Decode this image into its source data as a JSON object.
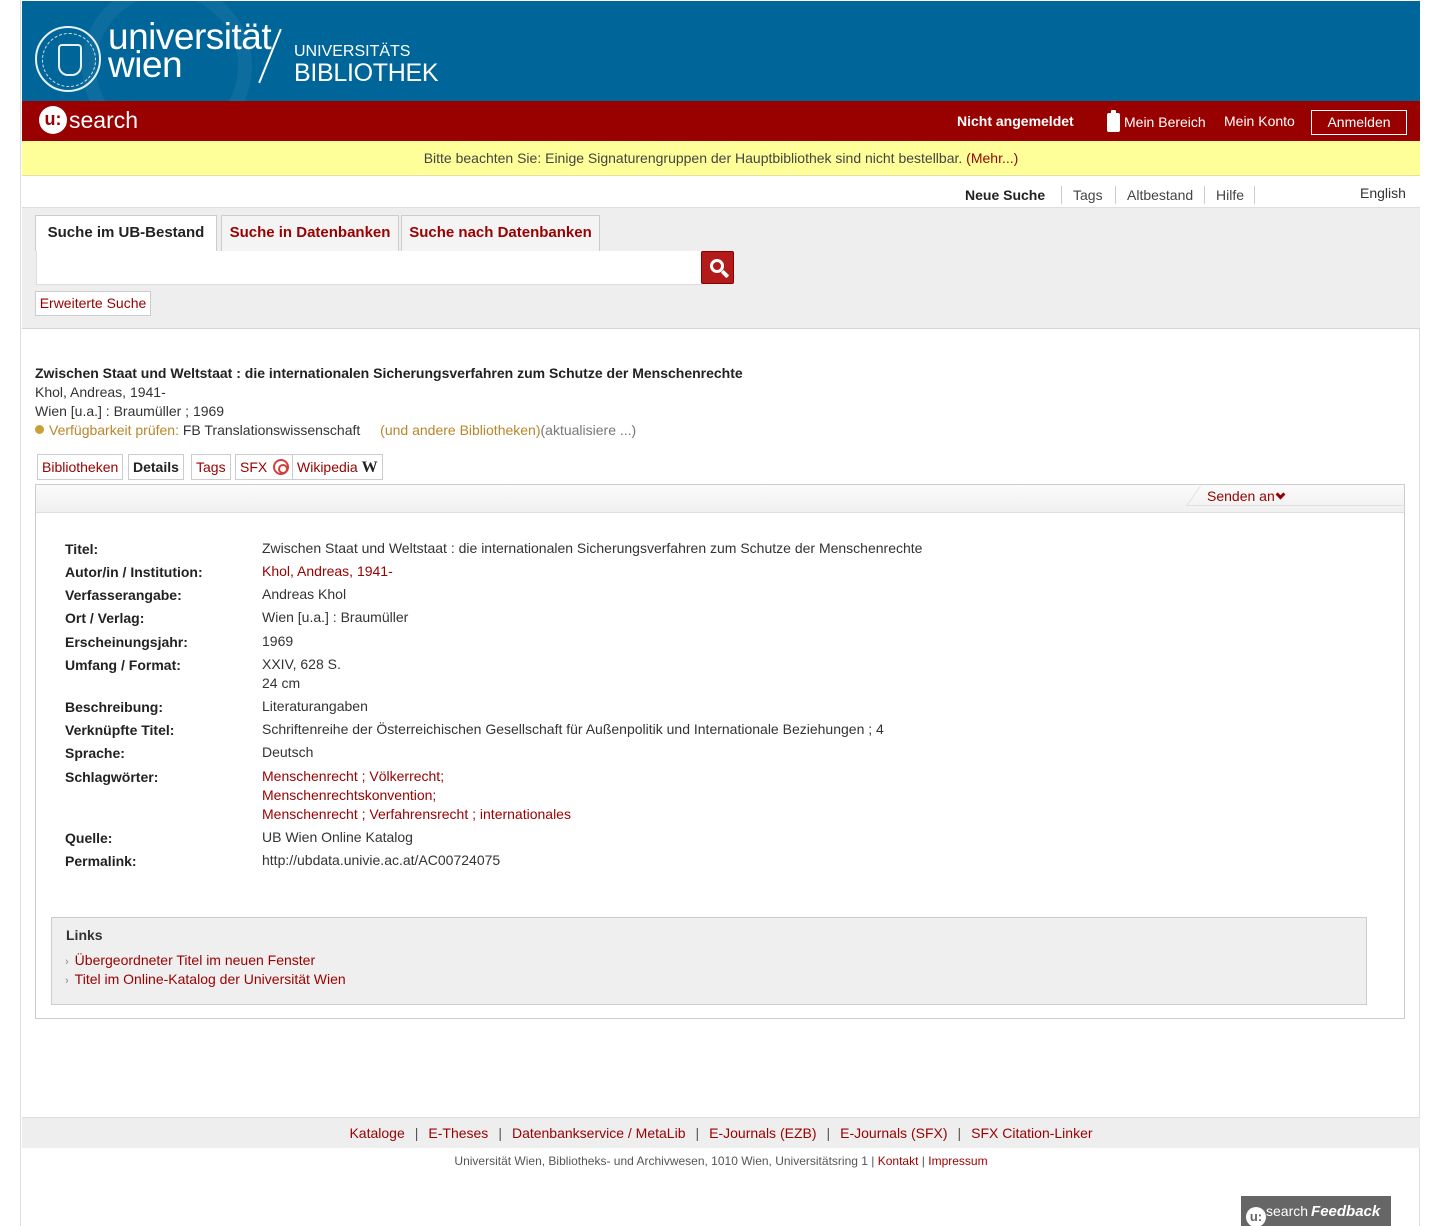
{
  "header": {
    "uni_line1": "universität",
    "uni_line2": "wien",
    "ub_line1": "UNIVERSITÄTS",
    "ub_line2": "BIBLIOTHEK"
  },
  "usearch": {
    "logo_u": "u:",
    "logo_text": "search"
  },
  "user": {
    "status": "Nicht angemeldet",
    "mein_bereich": "Mein Bereich",
    "mein_konto": "Mein Konto",
    "login_button": "Anmelden"
  },
  "notice": {
    "text": "Bitte beachten Sie: Einige Signaturengruppen der Hauptbibliothek sind nicht bestellbar.",
    "more": "(Mehr...)"
  },
  "topnav": {
    "items": [
      "Neue Suche",
      "Tags",
      "Altbestand",
      "Hilfe"
    ],
    "language": "English"
  },
  "search": {
    "tabs": [
      "Suche im UB-Bestand",
      "Suche in Datenbanken",
      "Suche nach Datenbanken"
    ],
    "query": "",
    "advanced": "Erweiterte Suche"
  },
  "record": {
    "title": "Zwischen Staat und Weltstaat : die internationalen Sicherungsverfahren zum Schutze der Menschenrechte",
    "author": "Khol, Andreas, 1941-",
    "imprint": "Wien [u.a.] : Braumüller ; 1969",
    "availability_label": "Verfügbarkeit prüfen:",
    "availability_location": "FB Translationswissenschaft",
    "other_libraries": "(und andere Bibliotheken)",
    "refresh": "(aktualisiere ...)",
    "tabs": [
      "Bibliotheken",
      "Details",
      "Tags",
      "SFX",
      "Wikipedia"
    ],
    "wiki_glyph": "W",
    "send_to": "Senden an"
  },
  "details": {
    "labels": {
      "titel": "Titel:",
      "autor": "Autor/in / Institution:",
      "verfasser": "Verfasserangabe:",
      "ort": "Ort / Verlag:",
      "jahr": "Erscheinungsjahr:",
      "umfang": "Umfang / Format:",
      "beschreibung": "Beschreibung:",
      "verknuepft": "Verknüpfte Titel:",
      "sprache": "Sprache:",
      "schlagwoerter": "Schlagwörter:",
      "quelle": "Quelle:",
      "permalink": "Permalink:"
    },
    "titel": "Zwischen Staat und Weltstaat : die internationalen Sicherungsverfahren zum Schutze der Menschenrechte",
    "autor": "Khol, Andreas, 1941-",
    "verfasser": "Andreas Khol",
    "ort": "Wien [u.a.] : Braumüller",
    "jahr": "1969",
    "umfang_1": "XXIV, 628 S.",
    "umfang_2": "24 cm",
    "beschreibung": "Literaturangaben",
    "verknuepft": "Schriftenreihe der Österreichischen Gesellschaft für Außenpolitik und Internationale Beziehungen ; 4",
    "sprache": "Deutsch",
    "schlagwoerter": {
      "row1": [
        "Menschenrecht",
        "Völkerrecht;"
      ],
      "row2": "Menschenrechtskonvention;",
      "row3": [
        "Menschenrecht",
        "Verfahrensrecht",
        "internationales"
      ],
      "sep": " ; "
    },
    "quelle": "UB Wien Online Katalog",
    "permalink": "http://ubdata.univie.ac.at/AC00724075"
  },
  "links": {
    "title": "Links",
    "items": [
      "Übergeordneter Titel im neuen Fenster",
      "Titel im Online-Katalog der Universität Wien"
    ]
  },
  "footer": {
    "links": [
      "Kataloge",
      "E-Theses",
      "Datenbankservice / MetaLib",
      "E-Journals (EZB)",
      "E-Journals (SFX)",
      "SFX Citation-Linker"
    ],
    "address": "Universität Wien, Bibliotheks- und Archivwesen, 1010 Wien, Universitätsring 1 |",
    "kontakt": "Kontakt",
    "impressum": "Impressum",
    "pipe": "|"
  },
  "feedback": {
    "u": "u:",
    "search": "search",
    "label": "Feedback"
  },
  "colors": {
    "brand_blue": "#006699",
    "brand_red": "#990000",
    "notice_yellow": "#ffff99"
  }
}
